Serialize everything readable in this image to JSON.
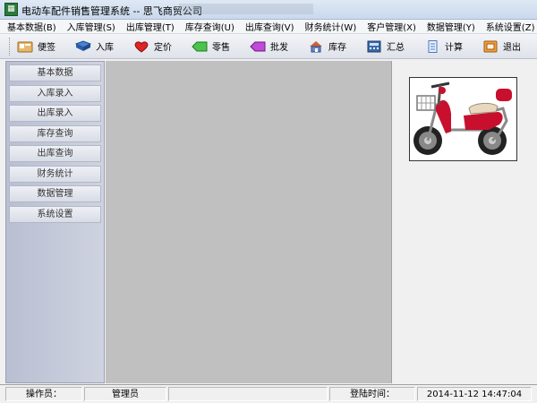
{
  "window": {
    "title": "电动车配件销售管理系统 -- 思飞商贸公司"
  },
  "menu": [
    "基本数据(B)",
    "入库管理(S)",
    "出库管理(T)",
    "库存查询(U)",
    "出库查询(V)",
    "财务统计(W)",
    "客户管理(X)",
    "数据管理(Y)",
    "系统设置(Z)"
  ],
  "toolbar": [
    {
      "label": "便签",
      "icon": "notes-icon",
      "color": "#c98a3a"
    },
    {
      "label": "入库",
      "icon": "book-icon",
      "color": "#3a6bb5"
    },
    {
      "label": "定价",
      "icon": "heart-icon",
      "color": "#d42020"
    },
    {
      "label": "零售",
      "icon": "green-tag-icon",
      "color": "#3bb43b"
    },
    {
      "label": "批发",
      "icon": "purple-tag-icon",
      "color": "#b040c8"
    },
    {
      "label": "库存",
      "icon": "house-icon",
      "color": "#5a7ab8"
    },
    {
      "label": "汇总",
      "icon": "calculator-icon",
      "color": "#3060a0"
    },
    {
      "label": "计算",
      "icon": "document-icon",
      "color": "#4a78c0"
    },
    {
      "label": "退出",
      "icon": "exit-icon",
      "color": "#e08a30"
    }
  ],
  "sidebar": [
    "基本数据",
    "入库录入",
    "出库录入",
    "库存查询",
    "出库查询",
    "财务统计",
    "数据管理",
    "系统设置"
  ],
  "status": {
    "operator_label": "操作员：",
    "operator_value": "管理员",
    "login_label": "登陆时间：",
    "login_value": "2014-11-12 14:47:04"
  }
}
